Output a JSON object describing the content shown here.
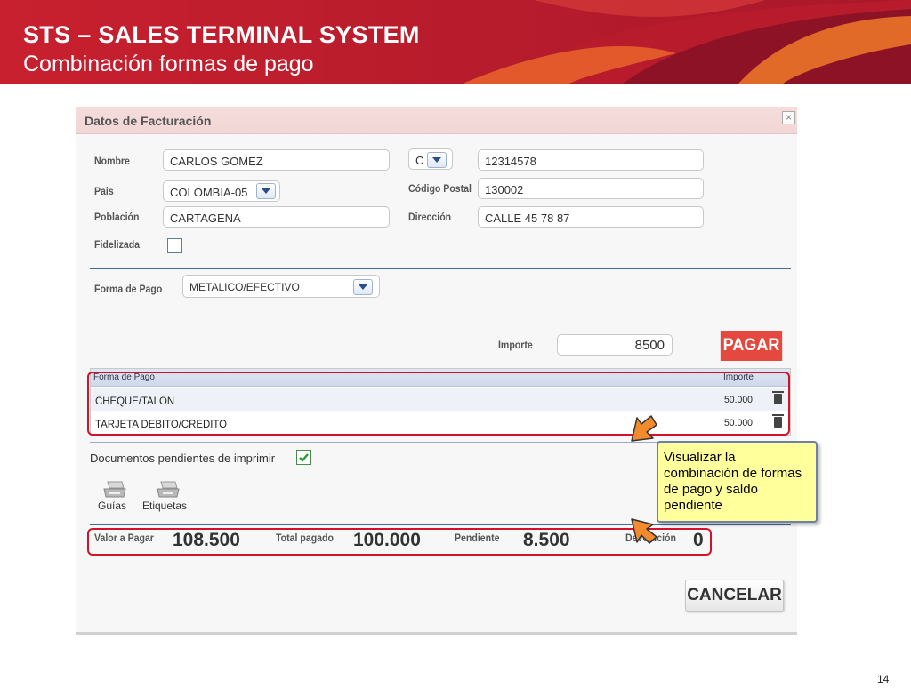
{
  "slide": {
    "title": "STS – SALES  TERMINAL SYSTEM",
    "subtitle": "Combinación formas de pago",
    "page_number": "14"
  },
  "dialog": {
    "title": "Datos de Facturación",
    "close_glyph": "×",
    "fields": {
      "nombre_label": "Nombre",
      "nombre_value": "CARLOS GOMEZ",
      "pais_label": "Pais",
      "pais_value": "COLOMBIA-05",
      "poblacion_label": "Población",
      "poblacion_value": "CARTAGENA",
      "fidelizada_label": "Fidelizada",
      "doc_type_value": "C",
      "doc_number_value": "12314578",
      "codigo_postal_label": "Código Postal",
      "codigo_postal_value": "130002",
      "direccion_label": "Dirección",
      "direccion_value": "CALLE 45 78 87",
      "forma_pago_label": "Forma de Pago",
      "forma_pago_value": "METALICO/EFECTIVO",
      "importe_label": "Importe",
      "importe_value": "8500"
    },
    "pagar_label": "PAGAR",
    "payment_table": {
      "headers": [
        "Forma de Pago",
        "Importe"
      ],
      "rows": [
        {
          "forma": "CHEQUE/TALON",
          "importe": "50.000"
        },
        {
          "forma": "TARJETA DEBITO/CREDITO",
          "importe": "50.000"
        }
      ]
    },
    "docs_pendientes_label": "Documentos pendientes de imprimir",
    "docs_pendientes_checked": true,
    "print_actions": [
      {
        "label": "Guías",
        "icon": "printer-icon"
      },
      {
        "label": "Etiquetas",
        "icon": "printer-icon"
      }
    ],
    "totals": {
      "valor_pagar_label": "Valor a Pagar",
      "valor_pagar_value": "108.500",
      "total_pagado_label": "Total pagado",
      "total_pagado_value": "100.000",
      "pendiente_label": "Pendiente",
      "pendiente_value": "8.500",
      "devolucion_label": "Devolución",
      "devolucion_value": "0"
    },
    "cancelar_label": "CANCELAR"
  },
  "callout": {
    "text": " Visualizar  la combinación de formas de pago y saldo pendiente"
  },
  "colors": {
    "brand_red": "#c8202e",
    "highlight_red": "#d0132a",
    "callout_yellow": "#ffff9c",
    "arrow_orange": "#f28a2e",
    "pagar_red": "#e4483e"
  }
}
